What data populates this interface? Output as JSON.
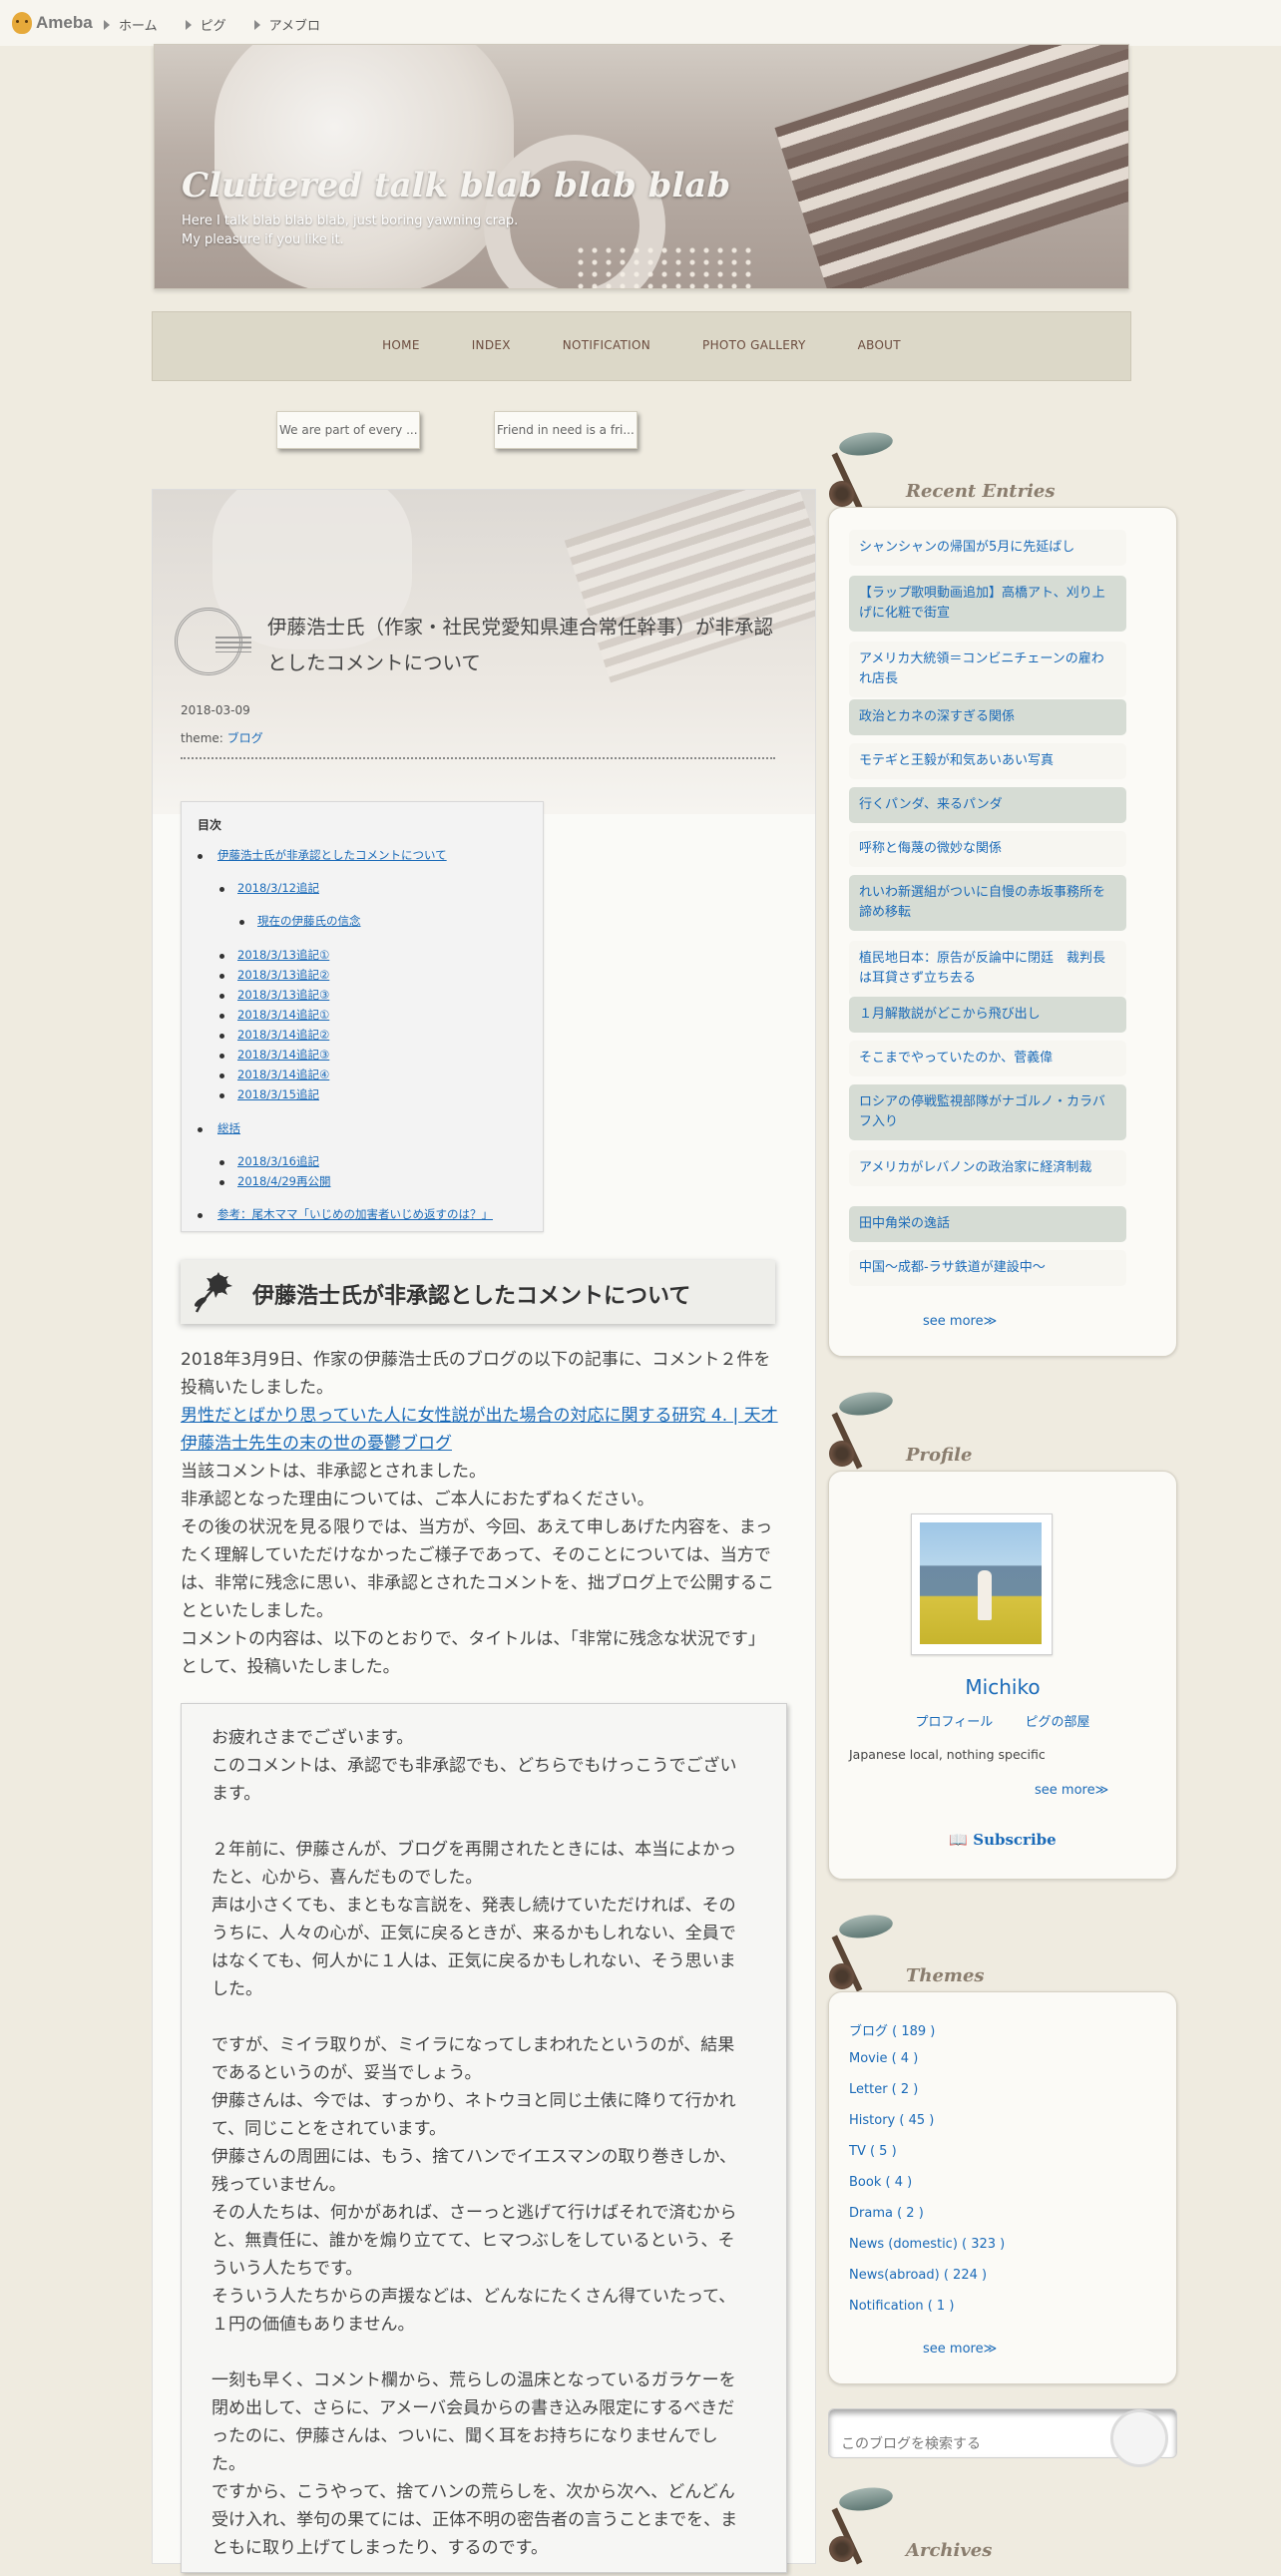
{
  "topbar": {
    "logo": "Ameba",
    "links": [
      "ホーム",
      "ピグ",
      "アメブロ"
    ]
  },
  "header": {
    "title": "Cluttered talk blab blab blab",
    "desc_line1": "Here I talk blab blab blab, just boring yawning crap.",
    "desc_line2": "My pleasure if you like it."
  },
  "nav": [
    "HOME",
    "INDEX",
    "NOTIFICATION",
    "PHOTO GALLERY",
    "ABOUT"
  ],
  "related": [
    "We are part of every ...",
    "Friend in need is a fri..."
  ],
  "article": {
    "title": "伊藤浩士氏（作家・社民党愛知県連合常任幹事）が非承認としたコメントについて",
    "date": "2018-03-09",
    "theme_label": "theme:",
    "theme": "ブログ",
    "toc": {
      "title": "目次",
      "items": [
        "伊藤浩士氏が非承認としたコメントについて",
        "2018/3/12追記",
        "現在の伊藤氏の信念",
        "2018/3/13追記①",
        "2018/3/13追記②",
        "2018/3/13追記③",
        "2018/3/14追記①",
        "2018/3/14追記②",
        "2018/3/14追記③",
        "2018/3/14追記④",
        "2018/3/15追記",
        "総括",
        "2018/3/16追記",
        "2018/4/29再公開",
        "参考：尾木ママ「いじめの加害者いじめ返すのは？」"
      ]
    },
    "section_heading": "伊藤浩士氏が非承認としたコメントについて",
    "p1": "2018年3月9日、作家の伊藤浩士氏のブログの以下の記事に、コメント２件を投稿いたしました。",
    "link": "男性だとばかり思っていた人に女性説が出た場合の対応に関する研究 4. | 天才伊藤浩士先生の末の世の憂鬱ブログ",
    "p2": "当該コメントは、非承認とされました。",
    "p3": "非承認となった理由については、ご本人におたずねください。",
    "p4": "その後の状況を見る限りでは、当方が、今回、あえて申しあげた内容を、まったく理解していただけなかったご様子であって、そのことについては、当方では、非常に残念に思い、非承認とされたコメントを、拙ブログ上で公開することといたしました。",
    "p5": "コメントの内容は、以下のとおりで、タイトルは、「非常に残念な状況です」として、投稿いたしました。",
    "quote": [
      "お疲れさまでございます。",
      "このコメントは、承認でも非承認でも、どちらでもけっこうでございます。",
      "",
      "２年前に、伊藤さんが、ブログを再開されたときには、本当によかったと、心から、喜んだものでした。",
      "声は小さくても、まともな言説を、発表し続けていただければ、そのうちに、人々の心が、正気に戻るときが、来るかもしれない、全員ではなくても、何人かに１人は、正気に戻るかもしれない、そう思いました。",
      "",
      "ですが、ミイラ取りが、ミイラになってしまわれたというのが、結果であるというのが、妥当でしょう。",
      "伊藤さんは、今では、すっかり、ネトウヨと同じ土俵に降りて行かれて、同じことをされています。",
      "伊藤さんの周囲には、もう、捨てハンでイエスマンの取り巻きしか、残っていません。",
      "その人たちは、何かがあれば、さーっと逃げて行けばそれで済むからと、無責任に、誰かを煽り立てて、ヒマつぶしをしているという、そういう人たちです。",
      "そういう人たちからの声援などは、どんなにたくさん得ていたって、１円の価値もありません。",
      "",
      "一刻も早く、コメント欄から、荒らしの温床となっているガラケーを閉め出して、さらに、アメーバ会員からの書き込み限定にするべきだったのに、伊藤さんは、ついに、聞く耳をお持ちになりませんでした。",
      "ですから、こうやって、捨てハンの荒らしを、次から次へ、どんどん受け入れ、挙句の果てには、正体不明の密告者の言うことまでを、まともに取り上げてしまったり、するのです。"
    ]
  },
  "sidebar": {
    "recent": {
      "title": "Recent Entries",
      "items": [
        "シャンシャンの帰国が5月に先延ばし",
        "【ラップ歌唄動画追加】高橋アト、刈り上げに化粧で街宣",
        "アメリカ大統領＝コンビニチェーンの雇われ店長",
        "政治とカネの深すぎる関係",
        "モテギと王毅が和気あいあい写真",
        "行くパンダ、来るパンダ",
        "呼称と侮蔑の微妙な関係",
        "れいわ新選組がついに自慢の赤坂事務所を諦め移転",
        "植民地日本：原告が反論中に閉廷　裁判長は耳貸さず立ち去る",
        "１月解散説がどこから飛び出し",
        "そこまでやっていたのか、菅義偉",
        "ロシアの停戦監視部隊がナゴルノ・カラバフ入り",
        "アメリカがレバノンの政治家に経済制裁",
        "田中角栄の逸話",
        "中国～成都-ラサ鉄道が建設中～"
      ],
      "see_more": "see more≫"
    },
    "profile": {
      "title": "Profile",
      "name": "Michiko",
      "link1": "プロフィール",
      "link2": "ピグの部屋",
      "desc": "Japanese local, nothing specific",
      "see_more": "see more≫",
      "subscribe": "Subscribe"
    },
    "themes": {
      "title": "Themes",
      "items": [
        "ブログ ( 189 )",
        "Movie ( 4 )",
        "Letter ( 2 )",
        "History ( 45 )",
        "TV ( 5 )",
        "Book ( 4 )",
        "Drama ( 2 )",
        "News (domestic) ( 323 )",
        "News(abroad) ( 224 )",
        "Notification ( 1 )"
      ],
      "see_more": "see more≫"
    },
    "search_placeholder": "このブログを検索する",
    "archives_title": "Archives"
  },
  "colors": {
    "link": "#1a6ab8",
    "background": "#efebe0",
    "nav_text": "#6b4b3e",
    "entry_alt": "#d6dcd4"
  }
}
